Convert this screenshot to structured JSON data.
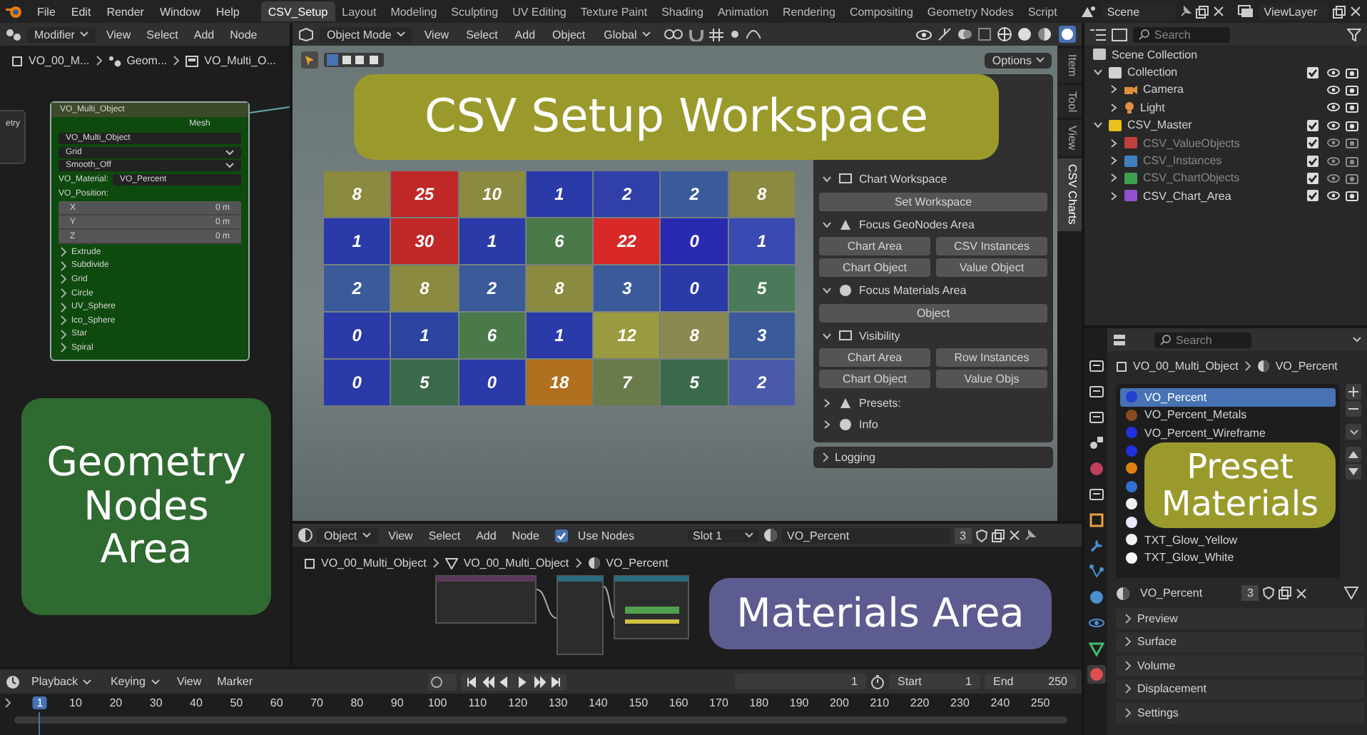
{
  "top_bar": {
    "menus": [
      "File",
      "Edit",
      "Render",
      "Window",
      "Help"
    ],
    "workspaces": [
      {
        "label": "CSV_Setup",
        "selected": true
      },
      {
        "label": "Layout",
        "selected": false
      },
      {
        "label": "Modeling",
        "selected": false
      },
      {
        "label": "Sculpting",
        "selected": false
      },
      {
        "label": "UV Editing",
        "selected": false
      },
      {
        "label": "Texture Paint",
        "selected": false
      },
      {
        "label": "Shading",
        "selected": false
      },
      {
        "label": "Animation",
        "selected": false
      },
      {
        "label": "Rendering",
        "selected": false
      },
      {
        "label": "Compositing",
        "selected": false
      },
      {
        "label": "Geometry Nodes",
        "selected": false
      },
      {
        "label": "Script",
        "selected": false
      }
    ],
    "scene": "Scene",
    "view_layer": "ViewLayer"
  },
  "geometry_nodes_editor": {
    "mode": "Modifier",
    "menus": [
      "View",
      "Select",
      "Add",
      "Node"
    ],
    "breadcrumb": [
      "VO_00_M...",
      "Geom...",
      "VO_Multi_O..."
    ],
    "input_socket": "etry",
    "node": {
      "title": "VO_Multi_Object",
      "output": "Mesh",
      "object": "VO_Multi_Object",
      "dropdowns": [
        "Grid",
        "Smooth_Off"
      ],
      "material_label": "VO_Material:",
      "material": "VO_Percent",
      "position_label": "VO_Position:",
      "position": [
        {
          "axis": "X",
          "value": "0 m"
        },
        {
          "axis": "Y",
          "value": "0 m"
        },
        {
          "axis": "Z",
          "value": "0 m"
        }
      ],
      "panels": [
        "Extrude",
        "Subdivide",
        "Grid",
        "Circle",
        "UV_Sphere",
        "Ico_Sphere",
        "Star",
        "Spiral"
      ]
    },
    "annotation": {
      "lines": [
        "Geometry",
        "Nodes",
        "Area"
      ],
      "color": "#2f6a30"
    }
  },
  "viewport": {
    "mode": "Object Mode",
    "menus": [
      "View",
      "Select",
      "Add",
      "Object"
    ],
    "orientation": "Global",
    "options": "Options",
    "chart_rows": [
      {
        "tiles": [
          {
            "value": "8",
            "color": "#8a8a40"
          },
          {
            "value": "25",
            "color": "#c02828"
          },
          {
            "value": "10",
            "color": "#8a8a40"
          },
          {
            "value": "1",
            "color": "#2a3aa8"
          },
          {
            "value": "2",
            "color": "#3040a8"
          },
          {
            "value": "2",
            "color": "#3a5a9a"
          },
          {
            "value": "8",
            "color": "#8a8a40"
          }
        ]
      },
      {
        "tiles": [
          {
            "value": "1",
            "color": "#2a3aa8"
          },
          {
            "value": "30",
            "color": "#c02828"
          },
          {
            "value": "1",
            "color": "#2a3aa8"
          },
          {
            "value": "6",
            "color": "#4a7a4a"
          },
          {
            "value": "22",
            "color": "#d82828"
          },
          {
            "value": "0",
            "color": "#2a2ab0"
          },
          {
            "value": "1",
            "color": "#3a4ab0"
          }
        ]
      },
      {
        "tiles": [
          {
            "value": "2",
            "color": "#3a5a9a"
          },
          {
            "value": "8",
            "color": "#8a8a40"
          },
          {
            "value": "2",
            "color": "#3a5a9a"
          },
          {
            "value": "8",
            "color": "#8a8a40"
          },
          {
            "value": "3",
            "color": "#3a5a9a"
          },
          {
            "value": "0",
            "color": "#2a3aa8"
          },
          {
            "value": "5",
            "color": "#4a7a5a"
          }
        ]
      },
      {
        "tiles": [
          {
            "value": "0",
            "color": "#2a3aa8"
          },
          {
            "value": "1",
            "color": "#2a44a0"
          },
          {
            "value": "6",
            "color": "#4a7a4a"
          },
          {
            "value": "1",
            "color": "#2a3aa8"
          },
          {
            "value": "12",
            "color": "#9a9a40"
          },
          {
            "value": "8",
            "color": "#8a8a50"
          },
          {
            "value": "3",
            "color": "#3a5a9a"
          }
        ]
      },
      {
        "tiles": [
          {
            "value": "0",
            "color": "#2a3aa8"
          },
          {
            "value": "5",
            "color": "#3a6a4a"
          },
          {
            "value": "0",
            "color": "#2a3aa8"
          },
          {
            "value": "18",
            "color": "#b07020"
          },
          {
            "value": "7",
            "color": "#6a7a4a"
          },
          {
            "value": "5",
            "color": "#3a6a4a"
          },
          {
            "value": "2",
            "color": "#4a5aaa"
          }
        ]
      }
    ],
    "annotation": {
      "lines": [
        "CSV Setup Workspace"
      ],
      "color": "#9a9a2c"
    },
    "sidebar_tabs": [
      {
        "label": "Item",
        "selected": false
      },
      {
        "label": "Tool",
        "selected": false
      },
      {
        "label": "View",
        "selected": false
      },
      {
        "label": "CSV Charts",
        "selected": true
      }
    ],
    "sidebar": {
      "sections": [
        {
          "title": "Chart Workspace",
          "expanded": true,
          "buttons": [
            "Set Workspace"
          ]
        },
        {
          "title": "Focus GeoNodes Area",
          "expanded": true,
          "buttons": [
            "Chart Area",
            "CSV Instances",
            "Chart Object",
            "Value Object"
          ]
        },
        {
          "title": "Focus Materials Area",
          "expanded": true,
          "buttons": [
            "Object"
          ]
        },
        {
          "title": "Visibility",
          "expanded": true,
          "buttons": [
            "Chart Area",
            "Row Instances",
            "Chart Object",
            "Value Objs"
          ]
        },
        {
          "title": "Presets:",
          "expanded": false
        },
        {
          "title": "Info",
          "expanded": false
        }
      ],
      "footer_panel": "Logging"
    }
  },
  "shader_editor": {
    "object": "Object",
    "menus": [
      "View",
      "Select",
      "Add",
      "Node"
    ],
    "use_nodes": {
      "label": "Use Nodes",
      "checked": true
    },
    "slot": "Slot 1",
    "material": "VO_Percent",
    "users": "3",
    "breadcrumb": [
      "VO_00_Multi_Object",
      "VO_00_Multi_Object",
      "VO_Percent"
    ],
    "annotation": {
      "lines": [
        "Materials Area"
      ],
      "color": "#5c5c90"
    }
  },
  "timeline": {
    "menus": [
      "Playback",
      "Keying",
      "View",
      "Marker"
    ],
    "current_frame": "1",
    "start_label": "Start",
    "start": "1",
    "end_label": "End",
    "end": "250",
    "ruler": [
      {
        "label": "1",
        "selected": true
      },
      {
        "label": "10",
        "selected": false
      },
      {
        "label": "20",
        "selected": false
      },
      {
        "label": "30",
        "selected": false
      },
      {
        "label": "40",
        "selected": false
      },
      {
        "label": "50",
        "selected": false
      },
      {
        "label": "60",
        "selected": false
      },
      {
        "label": "70",
        "selected": false
      },
      {
        "label": "80",
        "selected": false
      },
      {
        "label": "90",
        "selected": false
      },
      {
        "label": "100",
        "selected": false
      },
      {
        "label": "110",
        "selected": false
      },
      {
        "label": "120",
        "selected": false
      },
      {
        "label": "130",
        "selected": false
      },
      {
        "label": "140",
        "selected": false
      },
      {
        "label": "150",
        "selected": false
      },
      {
        "label": "160",
        "selected": false
      },
      {
        "label": "170",
        "selected": false
      },
      {
        "label": "180",
        "selected": false
      },
      {
        "label": "190",
        "selected": false
      },
      {
        "label": "200",
        "selected": false
      },
      {
        "label": "210",
        "selected": false
      },
      {
        "label": "220",
        "selected": false
      },
      {
        "label": "230",
        "selected": false
      },
      {
        "label": "240",
        "selected": false
      },
      {
        "label": "250",
        "selected": false
      }
    ]
  },
  "outliner": {
    "search_placeholder": "Search",
    "root": "Scene Collection",
    "tree": [
      {
        "label": "Collection",
        "kind": "collection",
        "color": "#d0d0d0",
        "expanded": true,
        "checked": true,
        "dimmed": false,
        "children": [
          {
            "label": "Camera",
            "kind": "camera",
            "expanded": false,
            "dimmed": false
          },
          {
            "label": "Light",
            "kind": "light",
            "expanded": false,
            "dimmed": false
          }
        ]
      },
      {
        "label": "CSV_Master",
        "kind": "collection",
        "color": "#e8c020",
        "expanded": true,
        "checked": true,
        "dimmed": false,
        "children": [
          {
            "label": "CSV_ValueObjects",
            "kind": "collection",
            "color": "#c04040",
            "expanded": false,
            "checked": true,
            "dimmed": true
          },
          {
            "label": "CSV_Instances",
            "kind": "collection",
            "color": "#4080c0",
            "expanded": false,
            "checked": true,
            "dimmed": true
          },
          {
            "label": "CSV_ChartObjects",
            "kind": "collection",
            "color": "#40a050",
            "expanded": false,
            "checked": true,
            "dimmed": true
          },
          {
            "label": "CSV_Chart_Area",
            "kind": "collection",
            "color": "#9050d0",
            "expanded": false,
            "checked": true,
            "dimmed": false
          }
        ]
      }
    ]
  },
  "properties": {
    "search_placeholder": "Search",
    "breadcrumb": [
      "VO_00_Multi_Object",
      "VO_Percent"
    ],
    "slots": [
      {
        "name": "VO_Percent",
        "color": "#2040d0",
        "selected": true
      },
      {
        "name": "VO_Percent_Metals",
        "color": "#8a4a20",
        "selected": false
      },
      {
        "name": "VO_Percent_Wireframe",
        "color": "#2030e0",
        "selected": false
      },
      {
        "color": "#2030e0",
        "selected": false
      },
      {
        "color": "#e08010",
        "selected": false
      },
      {
        "color": "#3070d0",
        "selected": false
      },
      {
        "color": "#f0f0f0",
        "selected": false
      },
      {
        "color": "#e8e8ff",
        "selected": false
      },
      {
        "name": "TXT_Glow_Yellow",
        "color": "#f0f0f0",
        "selected": false
      },
      {
        "name": "TXT_Glow_White",
        "color": "#f8f8f8",
        "selected": false
      }
    ],
    "material": "VO_Percent",
    "users": "3",
    "panels": [
      "Preview",
      "Surface",
      "Volume",
      "Displacement",
      "Settings"
    ],
    "annotation": {
      "lines": [
        "Preset",
        "Materials"
      ],
      "color": "#9a9a2c"
    }
  }
}
